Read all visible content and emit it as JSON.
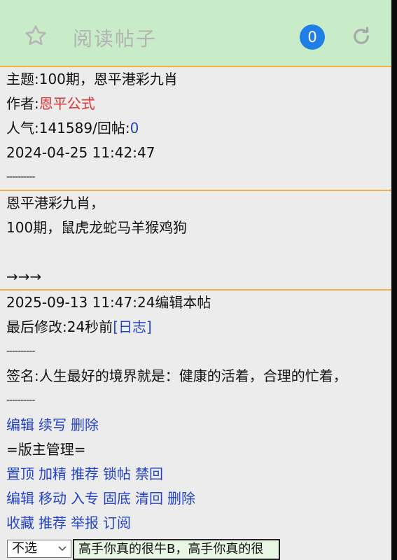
{
  "header": {
    "title": "阅读帖子",
    "badge": "0"
  },
  "post": {
    "subject": "主题:100期，恩平港彩九肖",
    "author_label": "作者:",
    "author_name": "恩平公式",
    "popularity_text": "人气:141589/回帖:",
    "reply_count": "0",
    "timestamp": "2024-04-25 11:42:47",
    "separator": "----------"
  },
  "body": {
    "line1": "恩平港彩九肖，",
    "line2": "100期，鼠虎龙蛇马羊猴鸡狗",
    "arrows": "→→→"
  },
  "footer": {
    "edit_time": "2025-09-13 11:47:24编辑本帖",
    "last_modified_label": "最后修改:24秒前",
    "log_link": "[日志]",
    "separator": "----------",
    "signature": "签名:人生最好的境界就是：健康的活着，合理的忙着，",
    "separator2": "----------"
  },
  "actions": {
    "row1": [
      "编辑",
      "续写",
      "删除"
    ],
    "admin_title": "=版主管理=",
    "row2": [
      "置顶",
      "加精",
      "推荐",
      "锁帖",
      "禁回"
    ],
    "row3": [
      "编辑",
      "移动",
      "入专",
      "固底",
      "清回",
      "删除"
    ],
    "row4": [
      "收藏",
      "推荐",
      "举报",
      "订阅"
    ]
  },
  "reply": {
    "select_value": "不选",
    "message_value": "高手你真的很牛B，高手你真的很"
  },
  "colors": {
    "header_bg": "#c9ecc8",
    "divider": "#f0b23c",
    "link_blue": "#2544c8",
    "author_red": "#e03030",
    "badge_blue": "#1f7fe6"
  }
}
